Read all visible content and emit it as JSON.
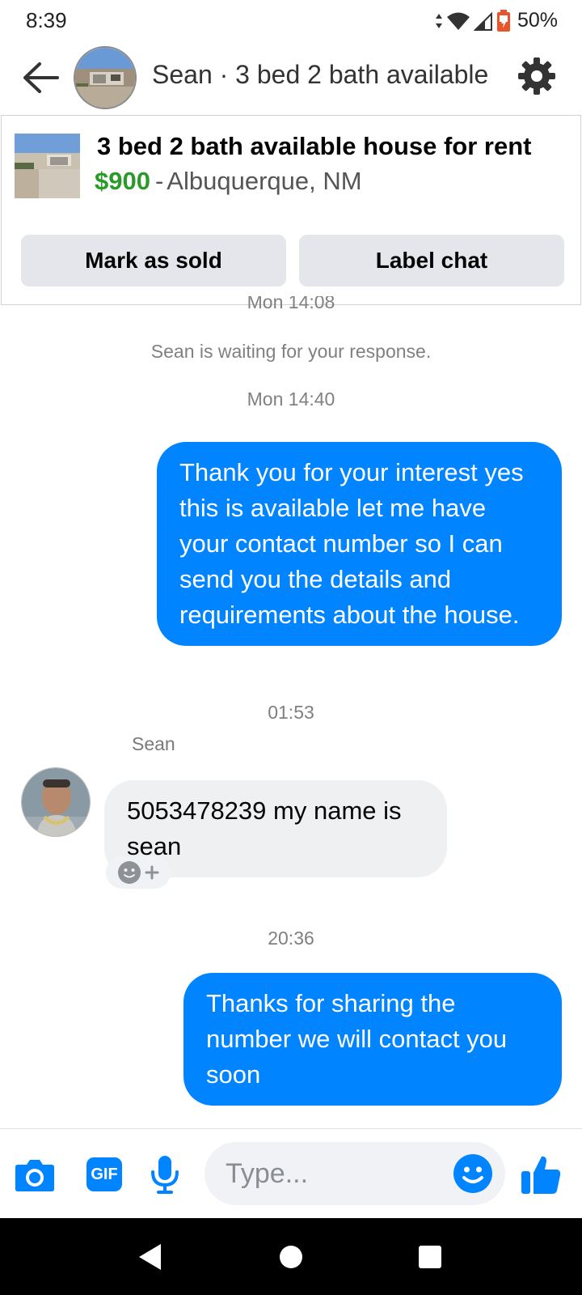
{
  "status_bar": {
    "time": "8:39",
    "battery": "50%"
  },
  "header": {
    "title": "Sean · 3 bed 2 bath available",
    "icons": [
      "back-arrow-icon",
      "gear-icon"
    ]
  },
  "listing": {
    "title": "3 bed 2 bath available house for rent",
    "price": "$900",
    "separator": "-",
    "location": "Albuquerque, NM",
    "mark_sold_label": "Mark as sold",
    "label_chat_label": "Label chat"
  },
  "chat": {
    "clipped_timestamp": "Mon 14:08",
    "waiting_notice": "Sean is waiting for your response.",
    "timestamp_1": "Mon 14:40",
    "message_1": "Thank you for your interest yes this is available let me have your contact number so I can send you the details and requirements about the house.",
    "timestamp_2": "01:53",
    "sender_name": "Sean",
    "message_2": "5053478239 my name is sean",
    "timestamp_3": "20:36",
    "message_3": "Thanks for sharing the number we will contact you soon"
  },
  "composer": {
    "placeholder": "Type...",
    "icons": [
      "camera-icon",
      "gif-icon",
      "microphone-icon",
      "emoji-icon",
      "thumbs-up-icon"
    ],
    "gif_label": "GIF"
  },
  "colors": {
    "accent": "#0084ff",
    "price": "#2a9a2a"
  }
}
